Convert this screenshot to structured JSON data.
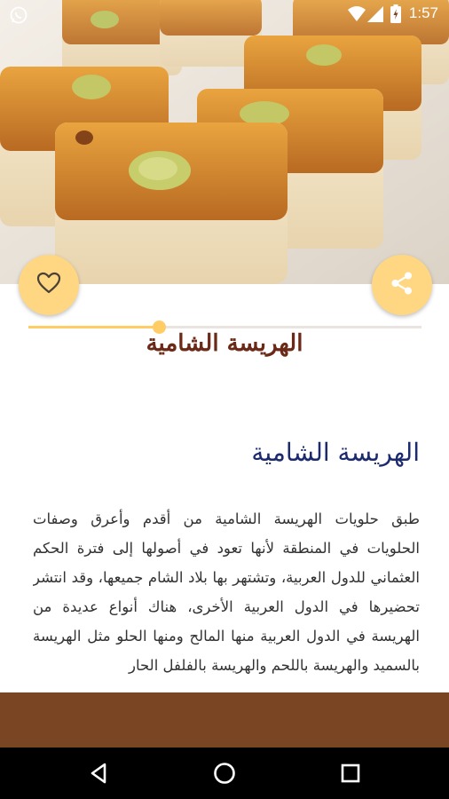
{
  "status_bar": {
    "time": "1:57",
    "icons": [
      "whatsapp-icon",
      "wifi-icon",
      "signal-icon",
      "battery-icon"
    ]
  },
  "hero": {
    "image": "Harissa semolina cake squares with pistachio topping"
  },
  "actions": {
    "favorite_icon": "heart-outline-icon",
    "share_icon": "share-icon"
  },
  "recipe": {
    "title": "الهريسة الشامية",
    "heading": "الهريسة الشامية",
    "body": "طبق حلويات الهريسة الشامية من أقدم وأعرق وصفات الحلويات في المنطقة لأنها تعود في أصولها إلى فترة الحكم العثماني للدول العربية، وتشتهر بها بلاد الشام جميعها، وقد انتشر تحضيرها في الدول العربية الأخرى، هناك أنواع عديدة من الهريسة في الدول العربية منها المالح ومنها الحلو مثل الهريسة بالسميد والهريسة باللحم والهريسة بالفلفل الحار"
  },
  "colors": {
    "accent": "#ffd783",
    "title": "#6b2a17",
    "heading": "#1c2a6e",
    "bottom_bar": "#7a4522"
  },
  "navigation": {
    "back_icon": "back-triangle-icon",
    "home_icon": "home-circle-icon",
    "recents_icon": "recents-square-icon"
  }
}
